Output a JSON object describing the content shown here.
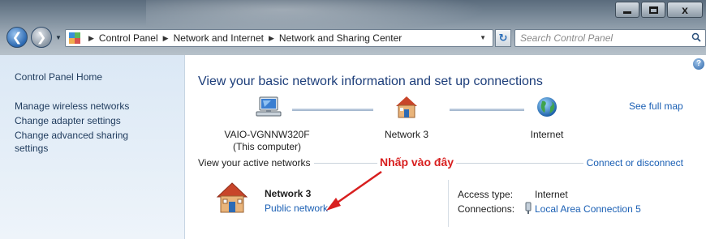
{
  "window": {
    "controls": {
      "minimize": "minimize",
      "maximize": "maximize",
      "close": "x"
    }
  },
  "address_bar": {
    "breadcrumb": [
      "Control Panel",
      "Network and Internet",
      "Network and Sharing Center"
    ],
    "search_placeholder": "Search Control Panel"
  },
  "sidebar": {
    "home": "Control Panel Home",
    "links": [
      "Manage wireless networks",
      "Change adapter settings",
      "Change advanced sharing settings"
    ]
  },
  "main": {
    "title": "View your basic network information and set up connections",
    "see_full_map": "See full map",
    "nodes": [
      {
        "name": "VAIO-VGNNW320F",
        "sub": "(This computer)",
        "icon": "computer-icon"
      },
      {
        "name": "Network 3",
        "sub": "",
        "icon": "house-icon"
      },
      {
        "name": "Internet",
        "sub": "",
        "icon": "globe-icon"
      }
    ],
    "active_networks_label": "View your active networks",
    "annotation": "Nhấp vào đây",
    "connect_link": "Connect or disconnect",
    "network": {
      "name": "Network 3",
      "type": "Public network",
      "access_type_label": "Access type:",
      "access_type_value": "Internet",
      "connections_label": "Connections:",
      "connections_value": "Local Area Connection 5"
    }
  },
  "colors": {
    "link": "#1a5fb4",
    "title": "#1d3e7a",
    "annotation": "#d81f1f",
    "sidebar_bg": "#dbe8f5"
  }
}
